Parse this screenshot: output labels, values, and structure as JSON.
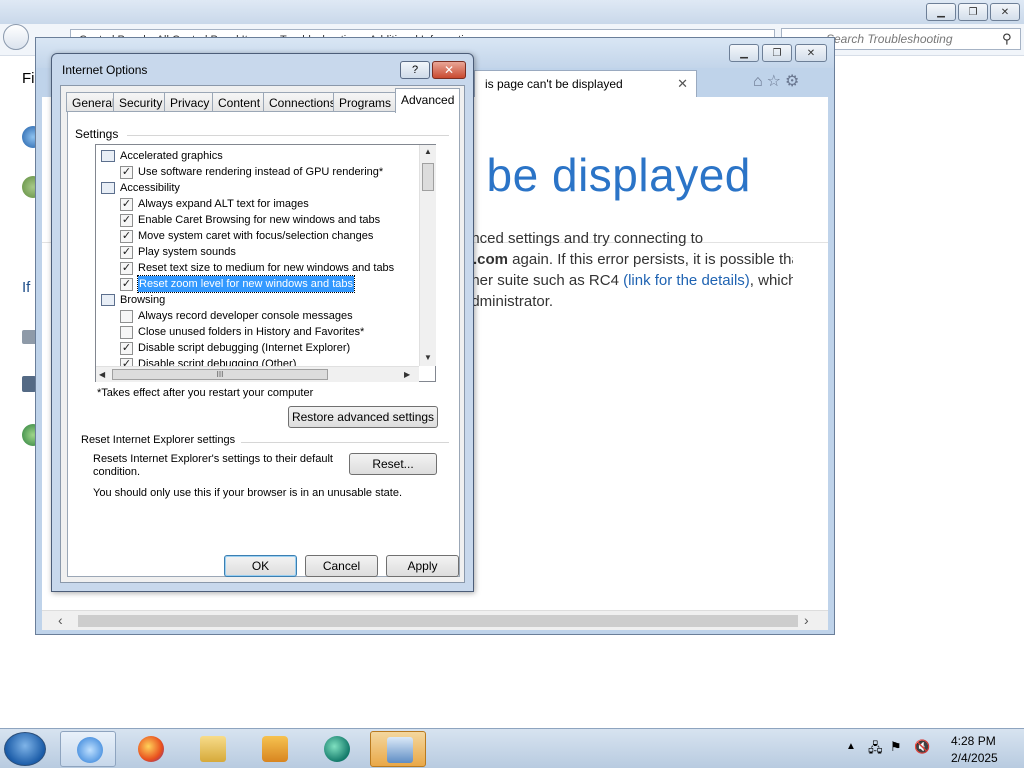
{
  "control_panel": {
    "address_text": "Control Panel  ▸  All Control Panel Items  ▸  Troubleshooting  ▸  Additional Information",
    "search_placeholder": "Search Troubleshooting",
    "side_text_1": "Fi",
    "side_text_2": "If"
  },
  "ie": {
    "tab_title": "is page can't be displayed",
    "error_title": "t be displayed",
    "body_line1": "anced settings and try connecting to",
    "body_line2_bold": "ft.com",
    "body_line2_rest": " again. If this error persists, it is possible tha",
    "body_line3_a": "pher suite such as RC4 ",
    "body_line3_link": "(link for the details)",
    "body_line3_b": ", which is ",
    "body_line4": "administrator."
  },
  "dialog": {
    "title": "Internet Options",
    "help_label": "?",
    "close_label": "✕",
    "tabs": [
      "General",
      "Security",
      "Privacy",
      "Content",
      "Connections",
      "Programs",
      "Advanced"
    ],
    "active_tab": "Advanced",
    "settings_label": "Settings",
    "settings_items": [
      {
        "type": "category",
        "label": "Accelerated graphics"
      },
      {
        "type": "check",
        "label": "Use software rendering instead of GPU rendering*",
        "checked": true
      },
      {
        "type": "category",
        "label": "Accessibility"
      },
      {
        "type": "check",
        "label": "Always expand ALT text for images",
        "checked": true
      },
      {
        "type": "check",
        "label": "Enable Caret Browsing for new windows and tabs",
        "checked": true
      },
      {
        "type": "check",
        "label": "Move system caret with focus/selection changes",
        "checked": true
      },
      {
        "type": "check",
        "label": "Play system sounds",
        "checked": true
      },
      {
        "type": "check",
        "label": "Reset text size to medium for new windows and tabs",
        "checked": true
      },
      {
        "type": "check",
        "label": "Reset zoom level for new windows and tabs",
        "checked": true,
        "selected": true
      },
      {
        "type": "category",
        "label": "Browsing"
      },
      {
        "type": "check",
        "label": "Always record developer console messages",
        "checked": false
      },
      {
        "type": "check",
        "label": "Close unused folders in History and Favorites*",
        "checked": false
      },
      {
        "type": "check",
        "label": "Disable script debugging (Internet Explorer)",
        "checked": true
      },
      {
        "type": "check",
        "label": "Disable script debugging (Other)",
        "checked": true
      }
    ],
    "restart_note": "*Takes effect after you restart your computer",
    "restore_button": "Restore advanced settings",
    "reset_group_label": "Reset Internet Explorer settings",
    "reset_desc": "Resets Internet Explorer's settings to their default condition.",
    "reset_button": "Reset...",
    "unusable_note": "You should only use this if your browser is in an unusable state.",
    "ok_button": "OK",
    "cancel_button": "Cancel",
    "apply_button": "Apply",
    "hscroll_grip": "III"
  },
  "taskbar": {
    "apps": [
      "internet-explorer",
      "firefox",
      "file-explorer",
      "media-player",
      "edge",
      "control-panel"
    ],
    "time": "4:28 PM",
    "date": "2/4/2025"
  }
}
